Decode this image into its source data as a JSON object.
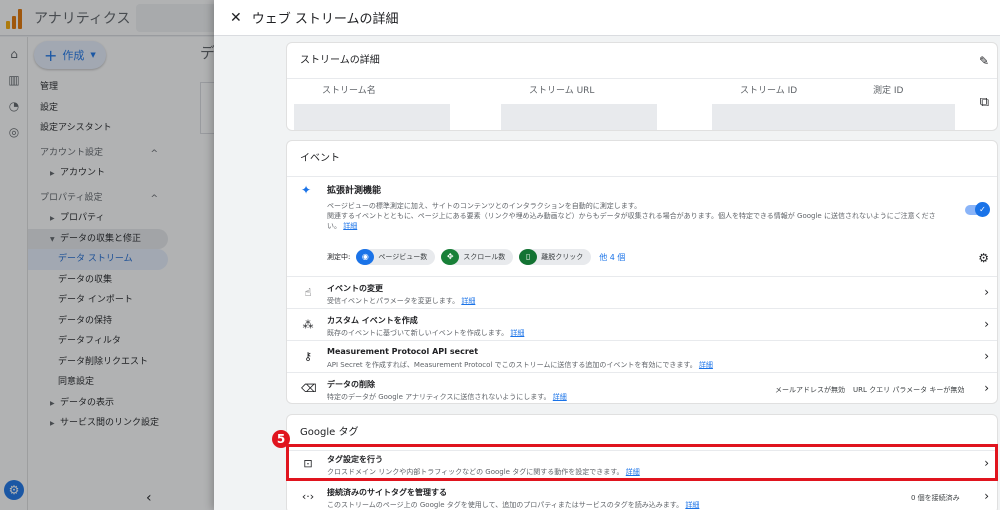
{
  "app": {
    "title": "アナリティクス"
  },
  "sidebar": {
    "create_label": "作成",
    "items": [
      {
        "label": "管理",
        "kind": "top"
      },
      {
        "label": "設定",
        "kind": "top"
      },
      {
        "label": "設定アシスタント",
        "kind": "top"
      },
      {
        "label": "アカウント設定",
        "kind": "section"
      },
      {
        "label": "アカウント",
        "kind": "sub"
      },
      {
        "label": "プロパティ設定",
        "kind": "section"
      },
      {
        "label": "プロパティ",
        "kind": "sub"
      },
      {
        "label": "データの収集と修正",
        "kind": "sub-expanded"
      },
      {
        "label": "データ ストリーム",
        "kind": "sub2-active"
      },
      {
        "label": "データの収集",
        "kind": "sub2"
      },
      {
        "label": "データ インポート",
        "kind": "sub2"
      },
      {
        "label": "データの保持",
        "kind": "sub2"
      },
      {
        "label": "データフィルタ",
        "kind": "sub2"
      },
      {
        "label": "データ削除リクエスト",
        "kind": "sub2"
      },
      {
        "label": "同意設定",
        "kind": "sub2"
      },
      {
        "label": "データの表示",
        "kind": "sub"
      },
      {
        "label": "サービス間のリンク設定",
        "kind": "sub"
      }
    ]
  },
  "underlying": {
    "letter": "デ"
  },
  "panel": {
    "title": "ウェブ ストリームの詳細",
    "stream_details": {
      "title": "ストリームの詳細",
      "columns": [
        "ストリーム名",
        "ストリーム URL",
        "ストリーム ID",
        "測定 ID"
      ]
    },
    "events": {
      "title": "イベント",
      "enhanced": {
        "title": "拡張計測機能",
        "desc1": "ページビューの標準測定に加え、サイトのコンテンツとのインタラクションを自動的に測定します。",
        "desc2": "関連するイベントとともに、ページ上にある要素（リンクや埋め込み動画など）からもデータが収集される場合があります。個人を特定できる情報が Google に送信されないようにご注意ください。",
        "desc_link": "詳細",
        "measuring_label": "測定中:",
        "chips": [
          "ページビュー数",
          "スクロール数",
          "離脱クリック"
        ],
        "more": "他 4 個"
      },
      "rows": [
        {
          "title": "イベントの変更",
          "desc": "受信イベントとパラメータを変更します。",
          "link": "詳細"
        },
        {
          "title": "カスタム イベントを作成",
          "desc": "既存のイベントに基づいて新しいイベントを作成します。",
          "link": "詳細"
        },
        {
          "title": "Measurement Protocol API secret",
          "desc": "API Secret を作成すれば、Measurement Protocol でこのストリームに送信する追加のイベントを有効にできます。",
          "link": "詳細"
        },
        {
          "title": "データの削除",
          "desc": "特定のデータが Google アナリティクスに送信されないようにします。",
          "link": "詳細",
          "right1": "メールアドレスが無効",
          "right2": "URL クエリ パラメータ キーが無効"
        }
      ]
    },
    "google_tag": {
      "title": "Google タグ",
      "rows": [
        {
          "title": "タグ設定を行う",
          "desc": "クロスドメイン リンクや内部トラフィックなどの Google タグに関する動作を設定できます。",
          "link": "詳細"
        },
        {
          "title": "接続済みのサイトタグを管理する",
          "desc": "このストリームのページ上の Google タグを使用して、追加のプロパティまたはサービスのタグを読み込みます。",
          "link": "詳細",
          "right": "0 個を接続済み"
        }
      ]
    },
    "step_badge": "5"
  },
  "colors": {
    "accent": "#1a73e8",
    "highlight": "#e0141e"
  }
}
